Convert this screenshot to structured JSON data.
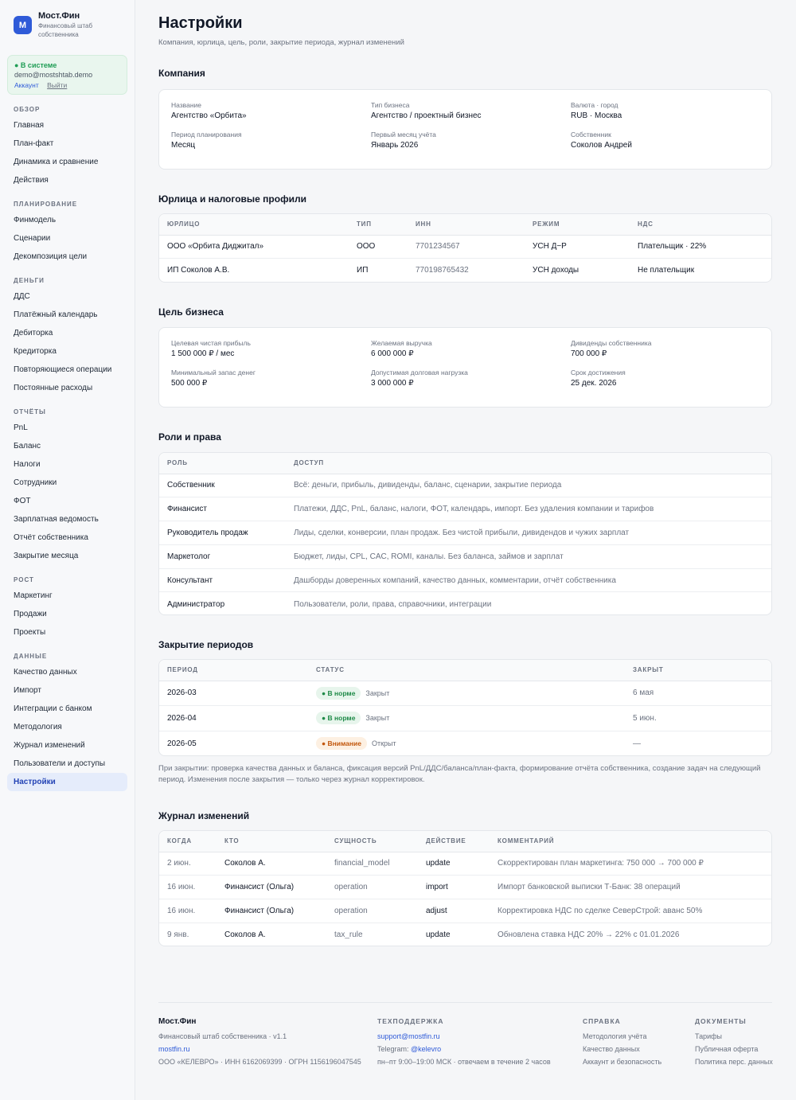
{
  "brand": {
    "logo_letter": "М",
    "name": "Мост.Фин",
    "subtitle": "Финансовый штаб собственника"
  },
  "session": {
    "status": "● В системе",
    "email": "demo@mostshtab.demo",
    "account_link": "Аккаунт",
    "logout_link": "Выйти"
  },
  "nav": [
    {
      "title": "ОБЗОР",
      "items": [
        "Главная",
        "План-факт",
        "Динамика и сравнение",
        "Действия"
      ]
    },
    {
      "title": "ПЛАНИРОВАНИЕ",
      "items": [
        "Финмодель",
        "Сценарии",
        "Декомпозиция цели"
      ]
    },
    {
      "title": "ДЕНЬГИ",
      "items": [
        "ДДС",
        "Платёжный календарь",
        "Дебиторка",
        "Кредиторка",
        "Повторяющиеся операции",
        "Постоянные расходы"
      ]
    },
    {
      "title": "ОТЧЁТЫ",
      "items": [
        "PnL",
        "Баланс",
        "Налоги",
        "Сотрудники",
        "ФОТ",
        "Зарплатная ведомость",
        "Отчёт собственника",
        "Закрытие месяца"
      ]
    },
    {
      "title": "РОСТ",
      "items": [
        "Маркетинг",
        "Продажи",
        "Проекты"
      ]
    },
    {
      "title": "ДАННЫЕ",
      "items": [
        "Качество данных",
        "Импорт",
        "Интеграции с банком",
        "Методология",
        "Журнал изменений",
        "Пользователи и доступы",
        "Настройки"
      ]
    }
  ],
  "active_nav": "Настройки",
  "page": {
    "title": "Настройки",
    "subtitle": "Компания, юрлица, цель, роли, закрытие периода, журнал изменений"
  },
  "company": {
    "title": "Компания",
    "fields": [
      {
        "label": "Название",
        "value": "Агентство «Орбита»"
      },
      {
        "label": "Тип бизнеса",
        "value": "Агентство / проектный бизнес"
      },
      {
        "label": "Валюта · город",
        "value": "RUB · Москва"
      },
      {
        "label": "Период планирования",
        "value": "Месяц"
      },
      {
        "label": "Первый месяц учёта",
        "value": "Январь 2026"
      },
      {
        "label": "Собственник",
        "value": "Соколов Андрей"
      }
    ]
  },
  "entities": {
    "title": "Юрлица и налоговые профили",
    "columns": [
      "ЮРЛИЦО",
      "ТИП",
      "ИНН",
      "РЕЖИМ",
      "НДС"
    ],
    "rows": [
      [
        "ООО «Орбита Диджитал»",
        "ООО",
        "7701234567",
        "УСН Д−Р",
        "Плательщик · 22%"
      ],
      [
        "ИП Соколов А.В.",
        "ИП",
        "770198765432",
        "УСН доходы",
        "Не плательщик"
      ]
    ]
  },
  "goal": {
    "title": "Цель бизнеса",
    "fields": [
      {
        "label": "Целевая чистая прибыль",
        "value": "1 500 000 ₽ / мес"
      },
      {
        "label": "Желаемая выручка",
        "value": "6 000 000 ₽"
      },
      {
        "label": "Дивиденды собственника",
        "value": "700 000 ₽"
      },
      {
        "label": "Минимальный запас денег",
        "value": "500 000 ₽"
      },
      {
        "label": "Допустимая долговая нагрузка",
        "value": "3 000 000 ₽"
      },
      {
        "label": "Срок достижения",
        "value": "25 дек. 2026"
      }
    ]
  },
  "roles": {
    "title": "Роли и права",
    "columns": [
      "РОЛЬ",
      "ДОСТУП"
    ],
    "rows": [
      [
        "Собственник",
        "Всё: деньги, прибыль, дивиденды, баланс, сценарии, закрытие периода"
      ],
      [
        "Финансист",
        "Платежи, ДДС, PnL, баланс, налоги, ФОТ, календарь, импорт. Без удаления компании и тарифов"
      ],
      [
        "Руководитель продаж",
        "Лиды, сделки, конверсии, план продаж. Без чистой прибыли, дивидендов и чужих зарплат"
      ],
      [
        "Маркетолог",
        "Бюджет, лиды, CPL, CAC, ROMI, каналы. Без баланса, займов и зарплат"
      ],
      [
        "Консультант",
        "Дашборды доверенных компаний, качество данных, комментарии, отчёт собственника"
      ],
      [
        "Администратор",
        "Пользователи, роли, права, справочники, интеграции"
      ]
    ]
  },
  "closing": {
    "title": "Закрытие периодов",
    "columns": [
      "ПЕРИОД",
      "СТАТУС",
      "ЗАКРЫТ"
    ],
    "rows": [
      {
        "period": "2026-03",
        "badge": "● В норме",
        "badge_kind": "ok",
        "state": "Закрыт",
        "closed": "6 мая"
      },
      {
        "period": "2026-04",
        "badge": "● В норме",
        "badge_kind": "ok",
        "state": "Закрыт",
        "closed": "5 июн."
      },
      {
        "period": "2026-05",
        "badge": "● Внимание",
        "badge_kind": "warn",
        "state": "Открыт",
        "closed": "—"
      }
    ],
    "note": "При закрытии: проверка качества данных и баланса, фиксация версий PnL/ДДС/баланса/план-факта, формирование отчёта собственника, создание задач на следующий период. Изменения после закрытия — только через журнал корректировок."
  },
  "audit": {
    "title": "Журнал изменений",
    "columns": [
      "КОГДА",
      "КТО",
      "СУЩНОСТЬ",
      "ДЕЙСТВИЕ",
      "КОММЕНТАРИЙ"
    ],
    "rows": [
      [
        "2 июн.",
        "Соколов А.",
        "financial_model",
        "update",
        "Скорректирован план маркетинга: 750 000 → 700 000 ₽"
      ],
      [
        "16 июн.",
        "Финансист (Ольга)",
        "operation",
        "import",
        "Импорт банковской выписки Т-Банк: 38 операций"
      ],
      [
        "16 июн.",
        "Финансист (Ольга)",
        "operation",
        "adjust",
        "Корректировка НДС по сделке СеверСтрой: аванс 50%"
      ],
      [
        "9 янв.",
        "Соколов А.",
        "tax_rule",
        "update",
        "Обновлена ставка НДС 20% → 22% с 01.01.2026"
      ]
    ]
  },
  "footer": {
    "brand": {
      "name": "Мост.Фин",
      "tagline": "Финансовый штаб собственника · v1.1",
      "site": "mostfin.ru",
      "legal": "ООО «КЕЛЕВРО» · ИНН 6162069399 · ОГРН 1156196047545"
    },
    "support": {
      "title": "ТЕХПОДДЕРЖКА",
      "email": "support@mostfin.ru",
      "telegram_label": "Telegram:",
      "telegram": "@kelevro",
      "hours": "пн–пт 9:00–19:00 МСК · отвечаем в течение 2 часов"
    },
    "help": {
      "title": "СПРАВКА",
      "items": [
        "Методология учёта",
        "Качество данных",
        "Аккаунт и безопасность"
      ]
    },
    "docs": {
      "title": "ДОКУМЕНТЫ",
      "items": [
        "Тарифы",
        "Публичная оферта",
        "Политика перс. данных"
      ]
    }
  }
}
